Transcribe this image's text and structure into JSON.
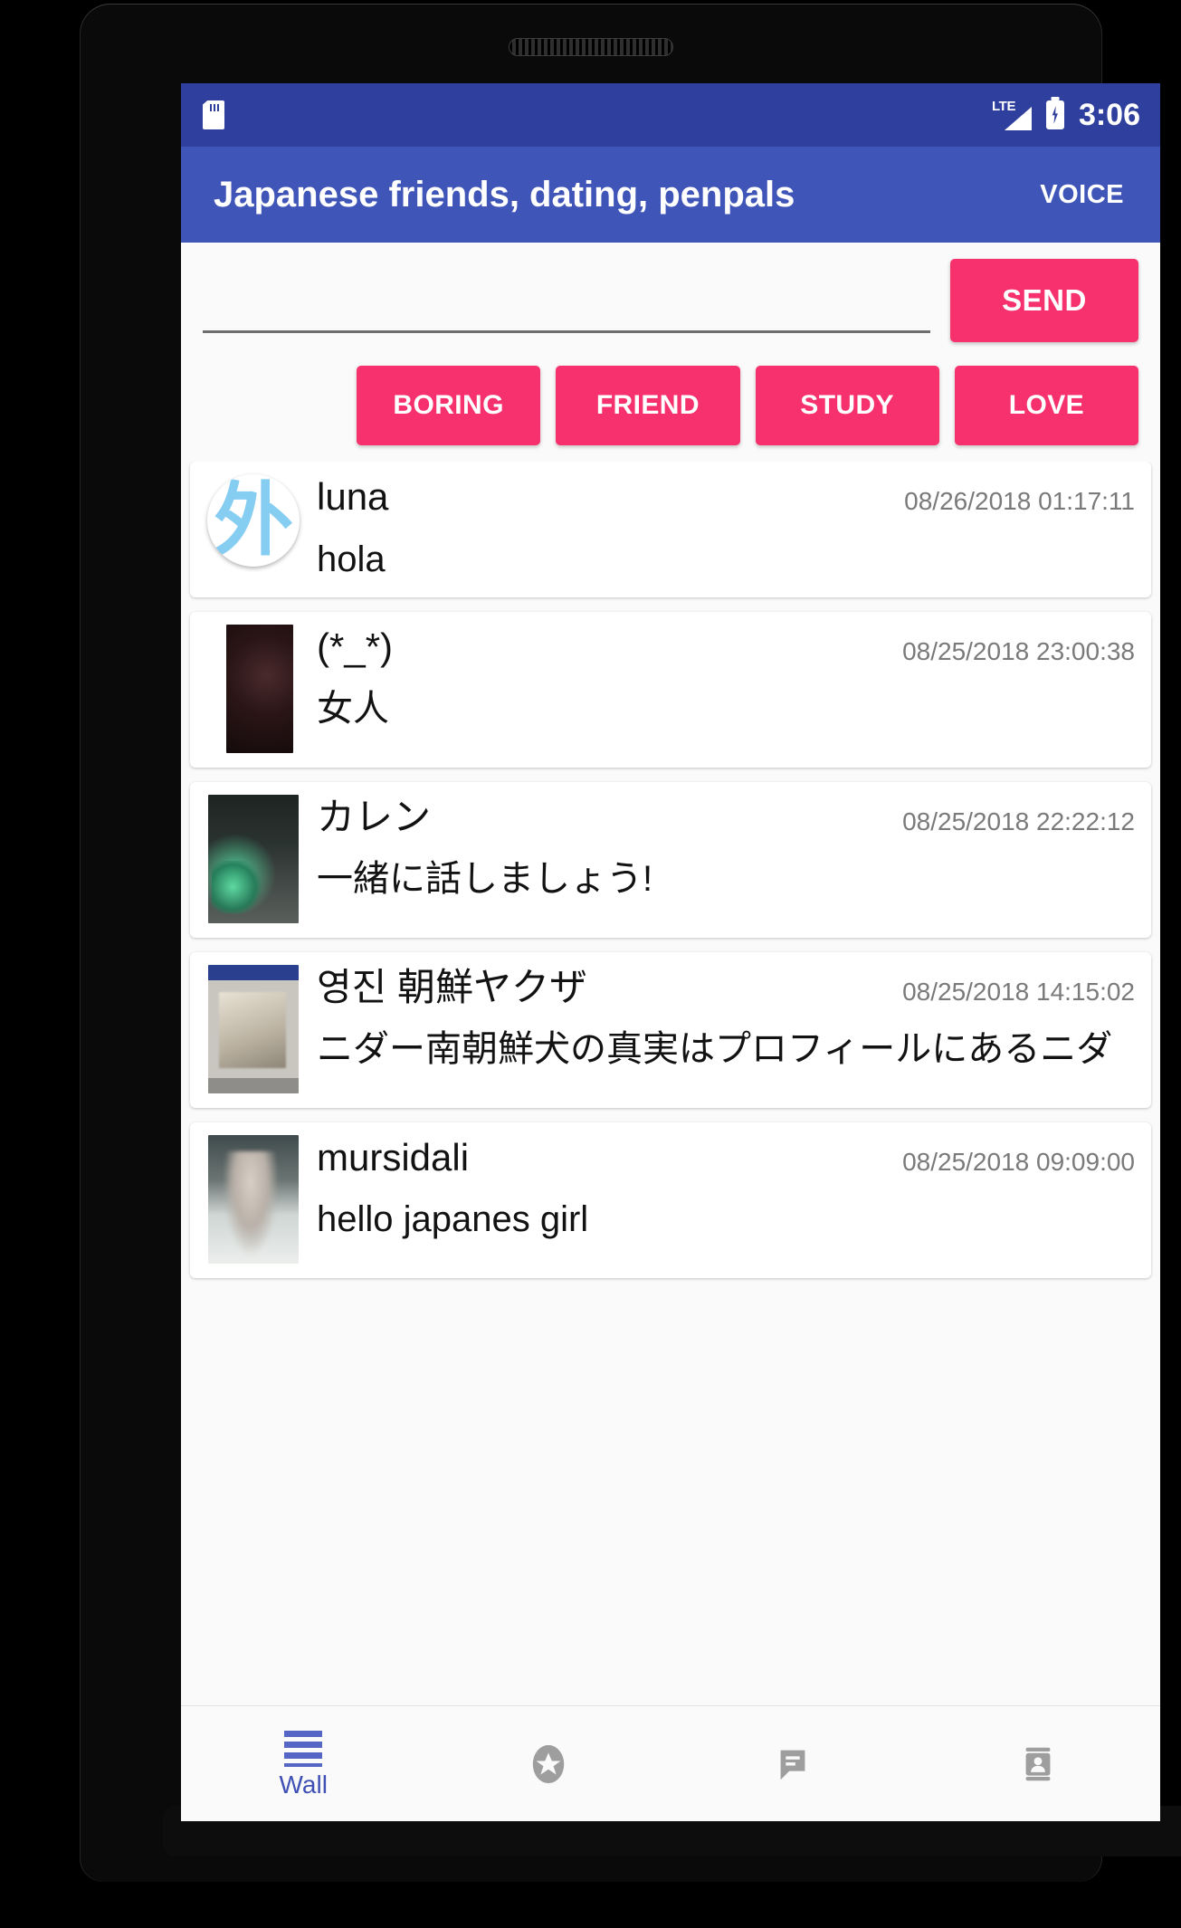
{
  "status_bar": {
    "sdcard_icon": "sd-card-icon",
    "network_label": "LTE",
    "battery_icon": "battery-charging-icon",
    "time": "3:06"
  },
  "app_bar": {
    "title": "Japanese friends, dating, penpals",
    "voice_label": "VOICE"
  },
  "compose": {
    "input_value": "",
    "input_placeholder": "",
    "send_label": "SEND"
  },
  "categories": [
    {
      "label": "BORING"
    },
    {
      "label": "FRIEND"
    },
    {
      "label": "STUDY"
    },
    {
      "label": "LOVE"
    }
  ],
  "posts": [
    {
      "avatar_type": "kanji",
      "avatar_glyph": "外",
      "user": "luna",
      "timestamp": "08/26/2018 01:17:11",
      "message": "hola"
    },
    {
      "avatar_type": "photo-dark",
      "avatar_glyph": "",
      "user": "(*_*)",
      "timestamp": "08/25/2018 23:00:38",
      "message": "女人"
    },
    {
      "avatar_type": "photo-night",
      "avatar_glyph": "",
      "user": "カレン",
      "timestamp": "08/25/2018 22:22:12",
      "message": "一緒に話しましょう!"
    },
    {
      "avatar_type": "photo-screenshot",
      "avatar_glyph": "",
      "user": "영진 朝鮮ヤクザ",
      "timestamp": "08/25/2018 14:15:02",
      "message": "ニダー南朝鮮犬の真実はプロフィールにあるニダ"
    },
    {
      "avatar_type": "photo-person",
      "avatar_glyph": "",
      "user": "mursidali",
      "timestamp": "08/25/2018 09:09:00",
      "message": "hello japanes girl"
    }
  ],
  "bottom_nav": [
    {
      "icon": "wall-lines-icon",
      "label": "Wall",
      "active": true
    },
    {
      "icon": "star-circle-icon",
      "label": "",
      "active": false
    },
    {
      "icon": "chat-bubble-icon",
      "label": "",
      "active": false
    },
    {
      "icon": "contacts-card-icon",
      "label": "",
      "active": false
    }
  ],
  "colors": {
    "status_bar": "#2f3f9e",
    "app_bar": "#4055b8",
    "accent_pink": "#f6316d",
    "nav_active": "#3f51b5",
    "avatar_kanji": "#86cdf2"
  }
}
